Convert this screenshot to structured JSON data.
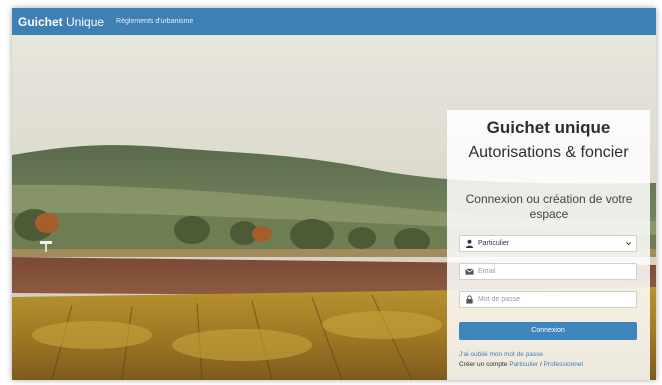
{
  "navbar": {
    "brand_bold": "Guichet",
    "brand_rest": "Unique",
    "link_regulations": "Règlements d'urbanisme"
  },
  "panel": {
    "title": "Guichet unique",
    "subtitle": "Autorisations & foncier",
    "heading": "Connexion ou création de votre espace",
    "account_type": {
      "selected": "Particulier",
      "icon": "user-icon"
    },
    "email": {
      "placeholder": "Email",
      "icon": "envelope-icon"
    },
    "password": {
      "placeholder": "Mot de passe",
      "icon": "lock-icon"
    },
    "submit_label": "Connexion",
    "forgot_password": "J'ai oublié mon mot de passe",
    "create_account_prefix": "Créer un compte",
    "create_particulier": "Particulier",
    "create_separator": "/",
    "create_professionnel": "Professionnel"
  },
  "colors": {
    "navbar": "#3e7fb4",
    "button": "#3e85bd",
    "link": "#3e7fb4"
  }
}
